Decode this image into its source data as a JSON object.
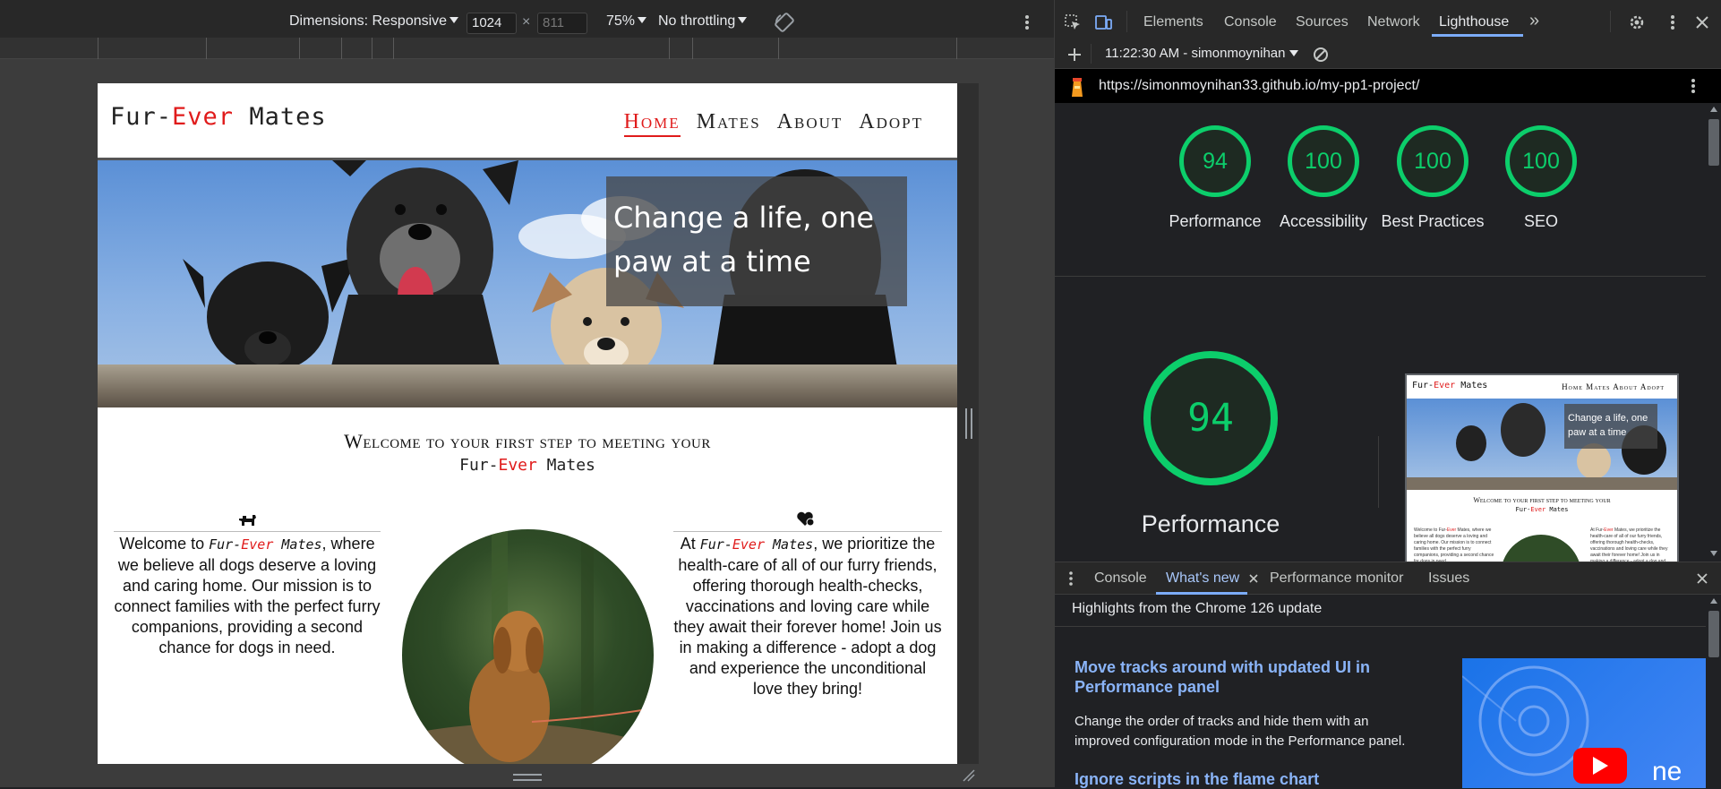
{
  "device_toolbar": {
    "dimensions_label": "Dimensions: Responsive",
    "width_value": "1024",
    "height_placeholder": "811",
    "times_symbol": "×",
    "zoom": "75%",
    "throttling": "No throttling"
  },
  "site": {
    "logo_prefix": "Fur-",
    "logo_highlight": "Ever",
    "logo_suffix": " Mates",
    "nav": [
      "Home",
      "Mates",
      "About",
      "Adopt"
    ],
    "active_nav": "Home",
    "hero_tagline": "Change a life, one paw at a time",
    "welcome_heading": "Welcome to your first step to meeting your",
    "left_col": {
      "text_before": "Welcome to ",
      "text_after": ", where we believe all dogs deserve a loving and caring home. Our mission is to connect families with the perfect furry companions, providing a second chance for dogs in need."
    },
    "right_col": {
      "text_before": "At ",
      "text_after": ", we prioritize the health-care of all of our furry friends, offering thorough health-checks, vaccinations and loving care while they await their forever home! Join us in making a difference - adopt a dog and experience the unconditional love they bring!"
    }
  },
  "devtools": {
    "tabs": [
      "Elements",
      "Console",
      "Sources",
      "Network",
      "Lighthouse"
    ],
    "active_tab": "Lighthouse",
    "more_tabs": "»",
    "report_selector": "11:22:30 AM - simonmoynihan",
    "report_url": "https://simonmoynihan33.github.io/my-pp1-project/",
    "scores": [
      {
        "label": "Performance",
        "value": "94"
      },
      {
        "label": "Accessibility",
        "value": "100"
      },
      {
        "label": "Best Practices",
        "value": "100"
      },
      {
        "label": "SEO",
        "value": "100"
      }
    ],
    "main_score": {
      "label": "Performance",
      "value": "94"
    },
    "thumb": {
      "logo_prefix": "Fur-",
      "logo_highlight": "Ever",
      "logo_suffix": " Mates",
      "nav": "Home Mates About Adopt",
      "tagline": "Change a life, one paw at a time",
      "welcome": "Welcome to your first step to meeting your"
    }
  },
  "drawer": {
    "tabs": [
      "Console",
      "What's new",
      "Performance monitor",
      "Issues"
    ],
    "active_tab": "What's new",
    "highlights": "Highlights from the Chrome 126 update",
    "items": [
      {
        "title": "Move tracks around with updated UI in Performance panel",
        "desc": "Change the order of tracks and hide them with an improved configuration mode in the Performance panel."
      },
      {
        "title": "Ignore scripts in the flame chart",
        "desc": ""
      }
    ],
    "image_text": "ne"
  },
  "colors": {
    "score_green": "#0cce6b",
    "brand_red": "#e01b1b",
    "devtools_accent": "#7cacf8"
  }
}
